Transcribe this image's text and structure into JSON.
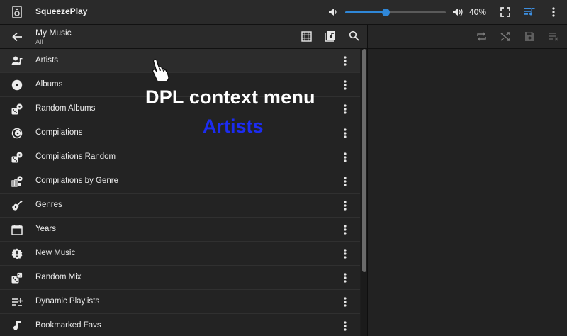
{
  "header": {
    "player_name": "SqueezePlay",
    "volume_percent": 40,
    "volume_label": "40%"
  },
  "nav": {
    "title": "My Music",
    "subtitle": "All"
  },
  "list": {
    "items": [
      {
        "label": "Artists",
        "icon": "artists-icon"
      },
      {
        "label": "Albums",
        "icon": "album-icon"
      },
      {
        "label": "Random Albums",
        "icon": "dice-album-icon"
      },
      {
        "label": "Compilations",
        "icon": "compilation-icon"
      },
      {
        "label": "Compilations Random",
        "icon": "dice-album-icon"
      },
      {
        "label": "Compilations by Genre",
        "icon": "genre-compilation-icon"
      },
      {
        "label": "Genres",
        "icon": "guitar-icon"
      },
      {
        "label": "Years",
        "icon": "calendar-icon"
      },
      {
        "label": "New Music",
        "icon": "new-badge-icon"
      },
      {
        "label": "Random Mix",
        "icon": "dice-icon"
      },
      {
        "label": "Dynamic Playlists",
        "icon": "dynamic-playlist-icon"
      },
      {
        "label": "Bookmarked Favs",
        "icon": "music-note-icon"
      }
    ]
  },
  "overlay": {
    "title": "DPL context menu",
    "subtitle": "Artists"
  },
  "colors": {
    "accent": "#2f87d8",
    "overlay_subtitle": "#1c2cf0"
  }
}
